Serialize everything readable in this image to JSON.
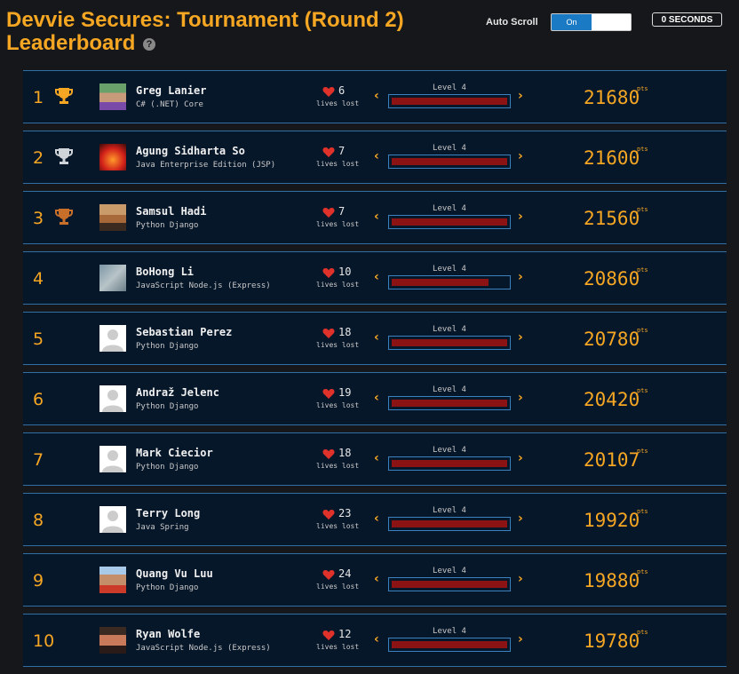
{
  "header": {
    "title": "Devvie Secures: Tournament (Round 2) Leaderboard",
    "help_icon": "question-circle-icon",
    "autoscroll_label": "Auto Scroll",
    "toggle_on_label": "On",
    "timer": "0 SECONDS"
  },
  "labels": {
    "lives_lost": "lives lost",
    "pts": "pts"
  },
  "colors": {
    "accent": "#f5a623",
    "row_bg": "#07172a",
    "row_border": "#2f6fa3",
    "bar_fill": "#8c1313",
    "toggle_on": "#1a7ac3"
  },
  "leaderboard": [
    {
      "rank": "1",
      "trophy": "gold",
      "name": "Greg Lanier",
      "tech": "C# (.NET) Core",
      "lives": "6",
      "level": "Level 4",
      "progress": 1.0,
      "score": "21680"
    },
    {
      "rank": "2",
      "trophy": "silver",
      "name": "Agung Sidharta So",
      "tech": "Java Enterprise Edition (JSP)",
      "lives": "7",
      "level": "Level 4",
      "progress": 1.0,
      "score": "21600"
    },
    {
      "rank": "3",
      "trophy": "bronze",
      "name": "Samsul Hadi",
      "tech": "Python Django",
      "lives": "7",
      "level": "Level 4",
      "progress": 1.0,
      "score": "21560"
    },
    {
      "rank": "4",
      "trophy": "",
      "name": "BoHong Li",
      "tech": "JavaScript Node.js (Express)",
      "lives": "10",
      "level": "Level 4",
      "progress": 0.84,
      "score": "20860"
    },
    {
      "rank": "5",
      "trophy": "",
      "name": "Sebastian Perez",
      "tech": "Python Django",
      "lives": "18",
      "level": "Level 4",
      "progress": 1.0,
      "score": "20780"
    },
    {
      "rank": "6",
      "trophy": "",
      "name": "Andraž Jelenc",
      "tech": "Python Django",
      "lives": "19",
      "level": "Level 4",
      "progress": 1.0,
      "score": "20420"
    },
    {
      "rank": "7",
      "trophy": "",
      "name": "Mark Ciecior",
      "tech": "Python Django",
      "lives": "18",
      "level": "Level 4",
      "progress": 1.0,
      "score": "20107"
    },
    {
      "rank": "8",
      "trophy": "",
      "name": "Terry Long",
      "tech": "Java Spring",
      "lives": "23",
      "level": "Level 4",
      "progress": 1.0,
      "score": "19920"
    },
    {
      "rank": "9",
      "trophy": "",
      "name": "Quang Vu Luu",
      "tech": "Python Django",
      "lives": "24",
      "level": "Level 4",
      "progress": 1.0,
      "score": "19880"
    },
    {
      "rank": "10",
      "trophy": "",
      "name": "Ryan Wolfe",
      "tech": "JavaScript Node.js (Express)",
      "lives": "12",
      "level": "Level 4",
      "progress": 1.0,
      "score": "19780"
    }
  ]
}
